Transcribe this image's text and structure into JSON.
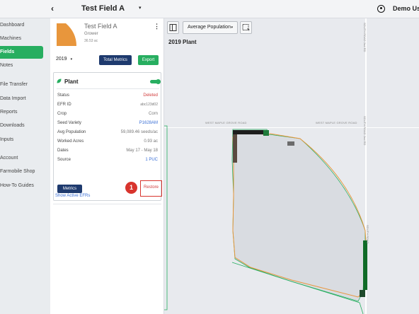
{
  "topbar": {
    "back_icon": "chevron-left-icon",
    "field_title": "Test Field A",
    "caret": "▾",
    "user_icon": "user-circle-icon",
    "user_name": "Demo User"
  },
  "sidebar": {
    "items": [
      {
        "label": "Dashboard",
        "active": false
      },
      {
        "label": "Machines",
        "active": false
      },
      {
        "label": "Fields",
        "active": true
      },
      {
        "label": "Notes",
        "active": false
      },
      {
        "label": "File Transfer",
        "active": false
      },
      {
        "label": "Data Import",
        "active": false
      },
      {
        "label": "Reports",
        "active": false
      },
      {
        "label": "Downloads",
        "active": false
      },
      {
        "label": "Inputs",
        "active": false
      },
      {
        "label": "Account",
        "active": false
      },
      {
        "label": "Farmobile Shop",
        "active": false
      },
      {
        "label": "How-To Guides",
        "active": false
      }
    ]
  },
  "panel": {
    "field_name": "Test Field A",
    "grower": "Grower",
    "acres": "36.53 ac",
    "menu": "⋮",
    "year": "2019",
    "year_caret": "▾",
    "total_metrics_label": "Total Metrics",
    "export_label": "Export",
    "card": {
      "title": "Plant",
      "toggle_on": true,
      "rows": [
        {
          "label": "Status",
          "value": "Deleted",
          "style": "red"
        },
        {
          "label": "EFR ID",
          "value": "abc123d02",
          "style": "small"
        },
        {
          "label": "Crop",
          "value": "Corn",
          "style": ""
        },
        {
          "label": "Seed Variety",
          "value": "P1628AM",
          "style": "blue"
        },
        {
          "label": "Avg Population",
          "value": "59,089.46 seeds/ac",
          "style": ""
        },
        {
          "label": "Worked Acres",
          "value": "0.93 ac",
          "style": ""
        },
        {
          "label": "Dates",
          "value": "May 17 - May 18",
          "style": ""
        },
        {
          "label": "Source",
          "value": "1 PUC",
          "style": "blue"
        }
      ],
      "metrics_label": "Metrics",
      "step_badge": "1",
      "restore_label": "Restore"
    },
    "show_active_label": "Show Active EFRs"
  },
  "map": {
    "layer_select": "Average Population",
    "layer_caret": "▾",
    "plant_label": "2019 Plant",
    "road_labels": {
      "west_maple_left": "WEST MAPLE GROVE ROAD",
      "west_maple_right": "WEST MAPLE GROVE ROAD",
      "south_top": "SOUTH ROAD 2nd RD",
      "south_mid": "SOUTH ROAD 2nd RD",
      "south_low": "SOUTH ROAD"
    }
  },
  "colors": {
    "accent_green": "#27ae60",
    "navy": "#1e3a6e",
    "alert_red": "#d8342d",
    "field_orange": "#e8963c"
  }
}
